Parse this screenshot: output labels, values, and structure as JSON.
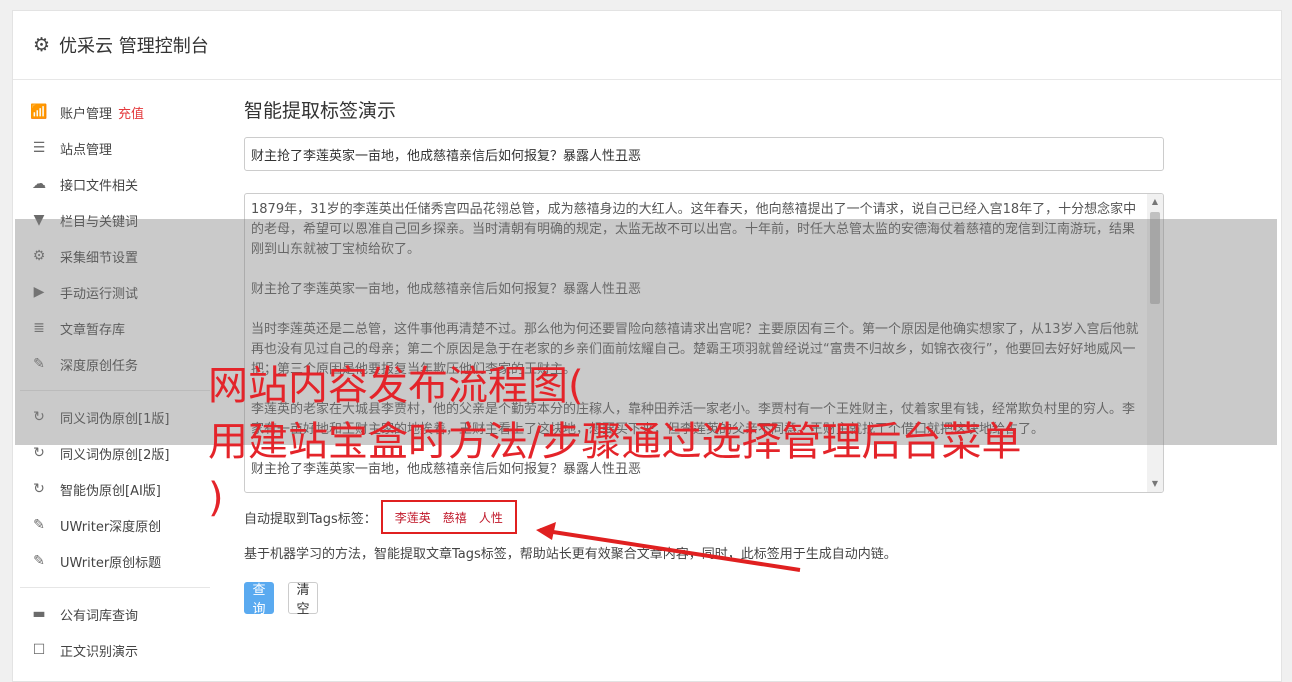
{
  "header": {
    "title": "优采云 管理控制台",
    "icon": "gear-icon"
  },
  "sidebar": {
    "items": [
      {
        "label": "账户管理",
        "extra": "充值",
        "icon": "bar-chart-icon",
        "glyph": "📶"
      },
      {
        "label": "站点管理",
        "icon": "server-icon",
        "glyph": "☰"
      },
      {
        "label": "接口文件相关",
        "icon": "cloud-upload-icon",
        "glyph": "☁"
      },
      {
        "label": "栏目与关键词",
        "icon": "filter-icon",
        "glyph": "▼"
      },
      {
        "label": "采集细节设置",
        "icon": "cogs-icon",
        "glyph": "⚙"
      },
      {
        "label": "手动运行测试",
        "icon": "play-circle-icon",
        "glyph": "▶"
      },
      {
        "label": "文章暂存库",
        "icon": "database-icon",
        "glyph": "≣"
      },
      {
        "label": "深度原创任务",
        "icon": "edit-icon",
        "glyph": "✎"
      }
    ],
    "items2": [
      {
        "label": "同义词伪原创[1版]",
        "icon": "refresh-icon",
        "glyph": "↻"
      },
      {
        "label": "同义词伪原创[2版]",
        "icon": "refresh-icon",
        "glyph": "↻"
      },
      {
        "label": "智能伪原创[AI版]",
        "icon": "refresh-icon",
        "glyph": "↻"
      },
      {
        "label": "UWriter深度原创",
        "icon": "edit-icon",
        "glyph": "✎"
      },
      {
        "label": "UWriter原创标题",
        "icon": "edit-icon",
        "glyph": "✎"
      }
    ],
    "items3": [
      {
        "label": "公有词库查询",
        "icon": "book-icon",
        "glyph": "▬"
      },
      {
        "label": "正文识别演示",
        "icon": "square-icon",
        "glyph": "☐"
      }
    ]
  },
  "main": {
    "heading": "智能提取标签演示",
    "title_value": "财主抢了李莲英家一亩地，他成慈禧亲信后如何报复？暴露人性丑恶",
    "content": "1879年，31岁的李莲英出任储秀宫四品花翎总管，成为慈禧身边的大红人。这年春天，他向慈禧提出了一个请求，说自己已经入宫18年了，十分想念家中的老母，希望可以恩准自己回乡探亲。当时清朝有明确的规定，太监无故不可以出宫。十年前，时任大总管太监的安德海仗着慈禧的宠信到江南游玩，结果刚到山东就被丁宝桢给砍了。\n\n财主抢了李莲英家一亩地，他成慈禧亲信后如何报复？暴露人性丑恶\n\n当时李莲英还是二总管，这件事他再清楚不过。那么他为何还要冒险向慈禧请求出宫呢？主要原因有三个。第一个原因是他确实想家了，从13岁入宫后他就再也没有见过自己的母亲；第二个原因是急于在老家的乡亲们面前炫耀自己。楚霸王项羽就曾经说过“富贵不归故乡，如锦衣夜行”，他要回去好好地威风一把；第三个原因是他要报复当年欺压他们李家的王财主。\n\n李莲英的老家在大城县李贾村，他的父亲是个勤劳本分的庄稼人，靠种田养活一家老小。李贾村有一个王姓财主，仗着家里有钱，经常欺负村里的穷人。李家有一亩好地和王财主家的地挨着，王财主看上了这块地，想要买下来，但李莲英的父亲不同意。王财主就找了个借口就把这块地给占了。\n\n财主抢了李莲英家一亩地，他成慈禧亲信后如何报复？暴露人性丑恶",
    "tags_label": "自动提取到Tags标签：",
    "tags": [
      "李莲英",
      "慈禧",
      "人性"
    ],
    "description": "基于机器学习的方法，智能提取文章Tags标签，帮助站长更有效聚合文章内容，同时，此标签用于生成自动内链。",
    "query_button": "查询",
    "clear_button": "清空"
  },
  "overlay": {
    "line1": "网站内容发布流程图(",
    "line2": "用建站宝盒时方法/步骤通过选择管理后台菜单",
    "line3": ")"
  },
  "colors": {
    "accent": "#5aaaf0",
    "tag": "#c0182a",
    "highlight": "#e02020",
    "overlay_text": "#e4242a"
  }
}
